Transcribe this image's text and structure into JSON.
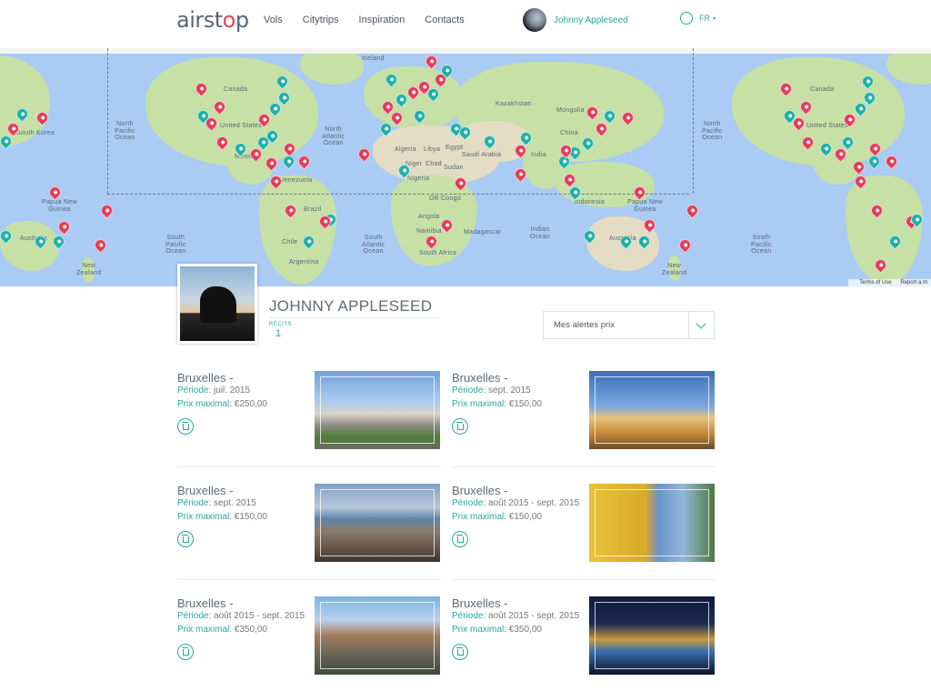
{
  "header": {
    "logo_text": "airstop",
    "nav": [
      "Vols",
      "Citytrips",
      "Inspiration",
      "Contacts"
    ],
    "user_name": "Johnny Appleseed",
    "language": "FR"
  },
  "map": {
    "labels": {
      "npo_w": "North\nPacific\nOcean",
      "nao": "North\nAtlantic\nOcean",
      "npo_e": "North\nPacific\nOcean",
      "spo_w": "South\nPacific\nOcean",
      "sao": "South\nAtlantic\nOcean",
      "io": "Indian\nOcean",
      "spo_e": "South\nPacific\nOcean",
      "canada_w": "Canada",
      "us_w": "United States",
      "canada_e": "Canada",
      "us_e": "United States",
      "mexico": "Mexico",
      "brazil": "Brazil",
      "venezuela": "Venezuela",
      "argentina": "Argentina",
      "chile": "Chile",
      "iceland": "Iceland",
      "algeria": "Algeria",
      "libya": "Libya",
      "egypt": "Egypt",
      "sudan": "Sudan",
      "chad": "Chad",
      "niger": "Niger",
      "nigeria": "Nigeria",
      "drc": "DR Congo",
      "angola": "Angola",
      "namibia": "Namibia",
      "south_africa": "South Africa",
      "madagascar": "Madagascar",
      "saudi": "Saudi Arabia",
      "mongolia": "Mongolia",
      "china": "China",
      "india": "India",
      "kazakhstan": "Kazakhstan",
      "indonesia": "Indonesia",
      "australia_w": "Australia",
      "png_w": "Papua New\nGuinea",
      "nz_w": "New\nZealand",
      "australia_e": "Australia",
      "png_e": "Papua New\nGuinea",
      "nz_e": "New\nZealand",
      "korea": "South Korea"
    },
    "footer": [
      "Terms of Use",
      "Report a m"
    ]
  },
  "profile": {
    "name": "JOHNNY APPLESEED",
    "recits_label": "RÉCITS",
    "recits_value": "1",
    "dropdown_value": "Mes alertes prix"
  },
  "alerts": [
    {
      "title": "Bruxelles -",
      "periode_label": "Période",
      "periode": ": juil. 2015",
      "prix_label": "Prix maximal",
      "prix": ": €250,00"
    },
    {
      "title": "Bruxelles -",
      "periode_label": "Période",
      "periode": ": sept. 2015",
      "prix_label": "Prix maximal",
      "prix": ": €150,00"
    },
    {
      "title": "Bruxelles -",
      "periode_label": "Période",
      "periode": ": sept. 2015",
      "prix_label": "Prix maximal",
      "prix": ": €150,00"
    },
    {
      "title": "Bruxelles -",
      "periode_label": "Période",
      "periode": ": août 2015 - sept. 2015",
      "prix_label": "Prix maximal",
      "prix": ": €150,00"
    },
    {
      "title": "Bruxelles -",
      "periode_label": "Période",
      "periode": ": août 2015 - sept. 2015",
      "prix_label": "Prix maximal",
      "prix": ": €350,00"
    },
    {
      "title": "Bruxelles -",
      "periode_label": "Période",
      "periode": ": août 2015 - sept. 2015",
      "prix_label": "Prix maximal",
      "prix": ": €350,00"
    }
  ],
  "colors": {
    "accent": "#2aa6a0",
    "pin_red": "#e23e58",
    "pin_teal": "#1fb0a8",
    "ocean": "#a9cbf4",
    "land": "#c6e0a6"
  }
}
